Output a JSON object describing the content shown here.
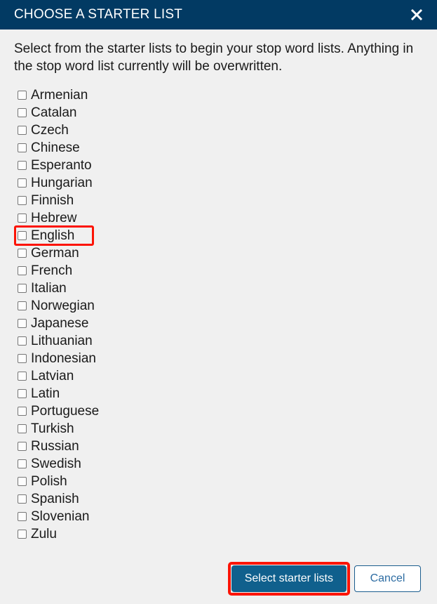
{
  "dialog": {
    "title": "CHOOSE A STARTER LIST",
    "close_icon": "close-icon",
    "intro": "Select from the starter lists to begin your stop word lists. Anything in the stop word list currently will be overwritten.",
    "accent_color": "#023a63",
    "primary_button_color": "#10608d",
    "highlight_color": "#fc1405",
    "background_color": "#f0f0f0"
  },
  "starter_lists": [
    {
      "label": "Armenian",
      "checked": false,
      "highlighted": false
    },
    {
      "label": "Catalan",
      "checked": false,
      "highlighted": false
    },
    {
      "label": "Czech",
      "checked": false,
      "highlighted": false
    },
    {
      "label": "Chinese",
      "checked": false,
      "highlighted": false
    },
    {
      "label": "Esperanto",
      "checked": false,
      "highlighted": false
    },
    {
      "label": "Hungarian",
      "checked": false,
      "highlighted": false
    },
    {
      "label": "Finnish",
      "checked": false,
      "highlighted": false
    },
    {
      "label": "Hebrew",
      "checked": false,
      "highlighted": false
    },
    {
      "label": "English",
      "checked": false,
      "highlighted": true
    },
    {
      "label": "German",
      "checked": false,
      "highlighted": false
    },
    {
      "label": "French",
      "checked": false,
      "highlighted": false
    },
    {
      "label": "Italian",
      "checked": false,
      "highlighted": false
    },
    {
      "label": "Norwegian",
      "checked": false,
      "highlighted": false
    },
    {
      "label": "Japanese",
      "checked": false,
      "highlighted": false
    },
    {
      "label": "Lithuanian",
      "checked": false,
      "highlighted": false
    },
    {
      "label": "Indonesian",
      "checked": false,
      "highlighted": false
    },
    {
      "label": "Latvian",
      "checked": false,
      "highlighted": false
    },
    {
      "label": "Latin",
      "checked": false,
      "highlighted": false
    },
    {
      "label": "Portuguese",
      "checked": false,
      "highlighted": false
    },
    {
      "label": "Turkish",
      "checked": false,
      "highlighted": false
    },
    {
      "label": "Russian",
      "checked": false,
      "highlighted": false
    },
    {
      "label": "Swedish",
      "checked": false,
      "highlighted": false
    },
    {
      "label": "Polish",
      "checked": false,
      "highlighted": false
    },
    {
      "label": "Spanish",
      "checked": false,
      "highlighted": false
    },
    {
      "label": "Slovenian",
      "checked": false,
      "highlighted": false
    },
    {
      "label": "Zulu",
      "checked": false,
      "highlighted": false
    }
  ],
  "footer": {
    "submit_label": "Select starter lists",
    "submit_highlighted": true,
    "cancel_label": "Cancel"
  }
}
